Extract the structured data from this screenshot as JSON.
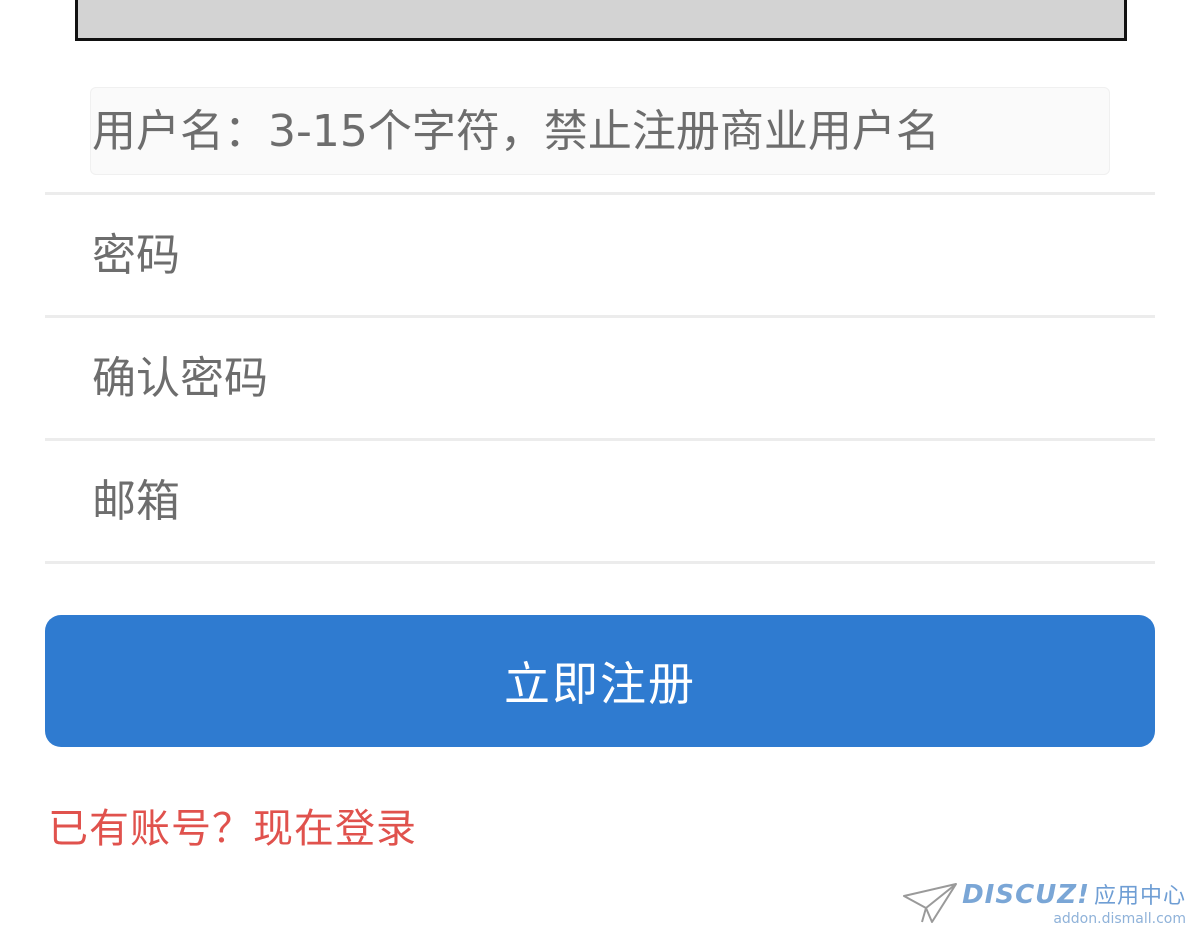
{
  "form": {
    "username_placeholder": "用户名：3-15个字符，禁止注册商业用户名",
    "password_placeholder": "密码",
    "confirm_password_placeholder": "确认密码",
    "email_placeholder": "邮箱",
    "submit_label": "立即注册"
  },
  "login_link": "已有账号？现在登录",
  "watermark": {
    "brand": "DISCUZ!",
    "brand_cn": "应用中心",
    "url": "addon.dismall.com"
  },
  "colors": {
    "primary": "#2f7bd0",
    "link": "#e0524d",
    "divider": "#ececec"
  },
  "icons": {
    "watermark_logo": "paper-plane-icon"
  }
}
